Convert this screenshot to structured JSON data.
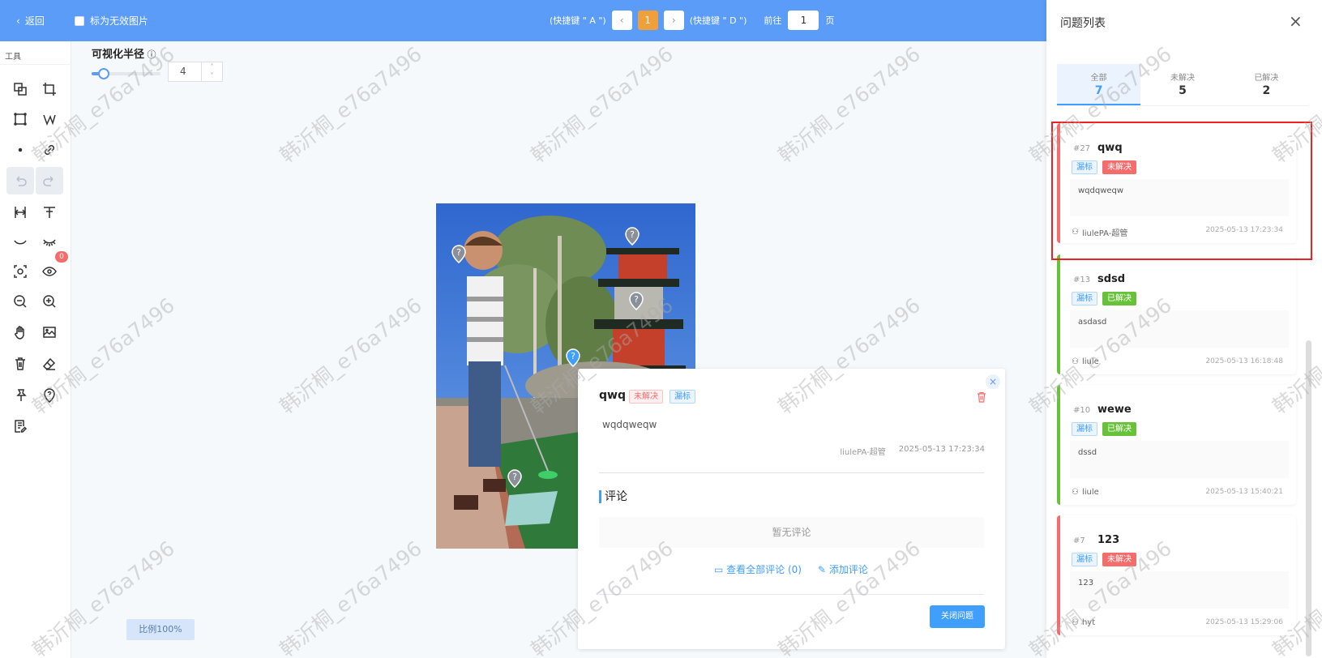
{
  "topbar": {
    "back_label": "返回",
    "mark_invalid_label": "标为无效图片",
    "shortcut_prev": "(快捷键 \" A \")",
    "current_page": "1",
    "shortcut_next": "(快捷键 \" D \")",
    "goto_prefix": "前往",
    "goto_value": "1",
    "goto_suffix": "页"
  },
  "toolbar": {
    "title": "工具",
    "eye_badge": "0"
  },
  "radius": {
    "label": "可视化半径",
    "value": "4",
    "slider_fraction": 0.18
  },
  "popup": {
    "title": "qwq",
    "status_tag": "未解决",
    "type_tag": "漏标",
    "description": "wqdqweqw",
    "author": "liulePA-超管",
    "time": "2025-05-13 17:23:34",
    "comments_heading": "评论",
    "no_comments": "暂无评论",
    "view_all_comments": "查看全部评论 (0)",
    "add_comment": "添加评论",
    "close_issue": "关闭问题"
  },
  "zoom": "比例100%",
  "panel": {
    "title": "问题列表",
    "tabs": [
      {
        "label": "全部",
        "count": "7"
      },
      {
        "label": "未解决",
        "count": "5"
      },
      {
        "label": "已解决",
        "count": "2"
      }
    ],
    "issues": [
      {
        "id": "#27",
        "title": "qwq",
        "type": "漏标",
        "status": "未解决",
        "desc": "wqdqweqw",
        "user": "liulePA-超管",
        "time": "2025-05-13 17:23:34"
      },
      {
        "id": "#13",
        "title": "sdsd",
        "type": "漏标",
        "status": "已解决",
        "desc": "asdasd",
        "user": "liule",
        "time": "2025-05-13 16:18:48"
      },
      {
        "id": "#10",
        "title": "wewe",
        "type": "漏标",
        "status": "已解决",
        "desc": "dssd",
        "user": "liule",
        "time": "2025-05-13 15:40:21"
      },
      {
        "id": "#7",
        "title": "123",
        "type": "漏标",
        "status": "未解决",
        "desc": "123",
        "user": "hyt",
        "time": "2025-05-13 15:29:06"
      }
    ]
  },
  "watermark": "韩沂桐_e76a7496",
  "colors": {
    "topbar": "#5a9cf8",
    "primary": "#409eff",
    "unresolved": "#f56c6c",
    "resolved": "#67c23a",
    "highlight": "#ee2222"
  }
}
